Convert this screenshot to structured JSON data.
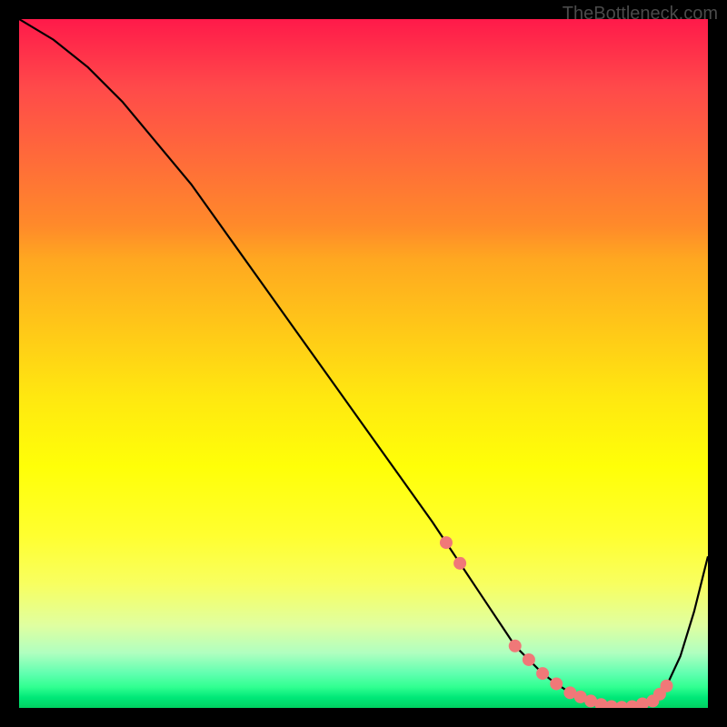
{
  "watermark": "TheBottleneck.com",
  "chart_data": {
    "type": "line",
    "title": "",
    "xlabel": "",
    "ylabel": "",
    "xlim": [
      0,
      100
    ],
    "ylim": [
      0,
      100
    ],
    "grid": false,
    "series": [
      {
        "name": "curve",
        "color": "#000000",
        "x": [
          0,
          5,
          10,
          15,
          20,
          25,
          30,
          35,
          40,
          45,
          50,
          55,
          60,
          62,
          64,
          66,
          68,
          70,
          72,
          74,
          76,
          78,
          80,
          82,
          84,
          86,
          88,
          90,
          92,
          94,
          96,
          98,
          100
        ],
        "y": [
          100,
          97,
          93,
          88,
          82,
          76,
          69,
          62,
          55,
          48,
          41,
          34,
          27,
          24,
          21,
          18,
          15,
          12,
          9,
          7,
          5,
          3.5,
          2.2,
          1.2,
          0.6,
          0.2,
          0.1,
          0.3,
          1.0,
          3.2,
          7.5,
          14,
          22
        ]
      }
    ],
    "dots": {
      "color": "#f07878",
      "radius": 7,
      "points": [
        {
          "x": 62,
          "y": 24
        },
        {
          "x": 64,
          "y": 21
        },
        {
          "x": 72,
          "y": 9
        },
        {
          "x": 74,
          "y": 7
        },
        {
          "x": 76,
          "y": 5
        },
        {
          "x": 78,
          "y": 3.5
        },
        {
          "x": 80,
          "y": 2.2
        },
        {
          "x": 81.5,
          "y": 1.6
        },
        {
          "x": 83,
          "y": 1.0
        },
        {
          "x": 84.5,
          "y": 0.5
        },
        {
          "x": 86,
          "y": 0.2
        },
        {
          "x": 87.5,
          "y": 0.1
        },
        {
          "x": 89,
          "y": 0.2
        },
        {
          "x": 90.5,
          "y": 0.6
        },
        {
          "x": 92,
          "y": 1.0
        },
        {
          "x": 93,
          "y": 2.0
        },
        {
          "x": 94,
          "y": 3.2
        }
      ]
    },
    "gradient_stops": [
      {
        "pos": 0,
        "color": "#ff1a4a"
      },
      {
        "pos": 50,
        "color": "#ffe810"
      },
      {
        "pos": 95,
        "color": "#60ffb0"
      },
      {
        "pos": 100,
        "color": "#00d060"
      }
    ]
  }
}
